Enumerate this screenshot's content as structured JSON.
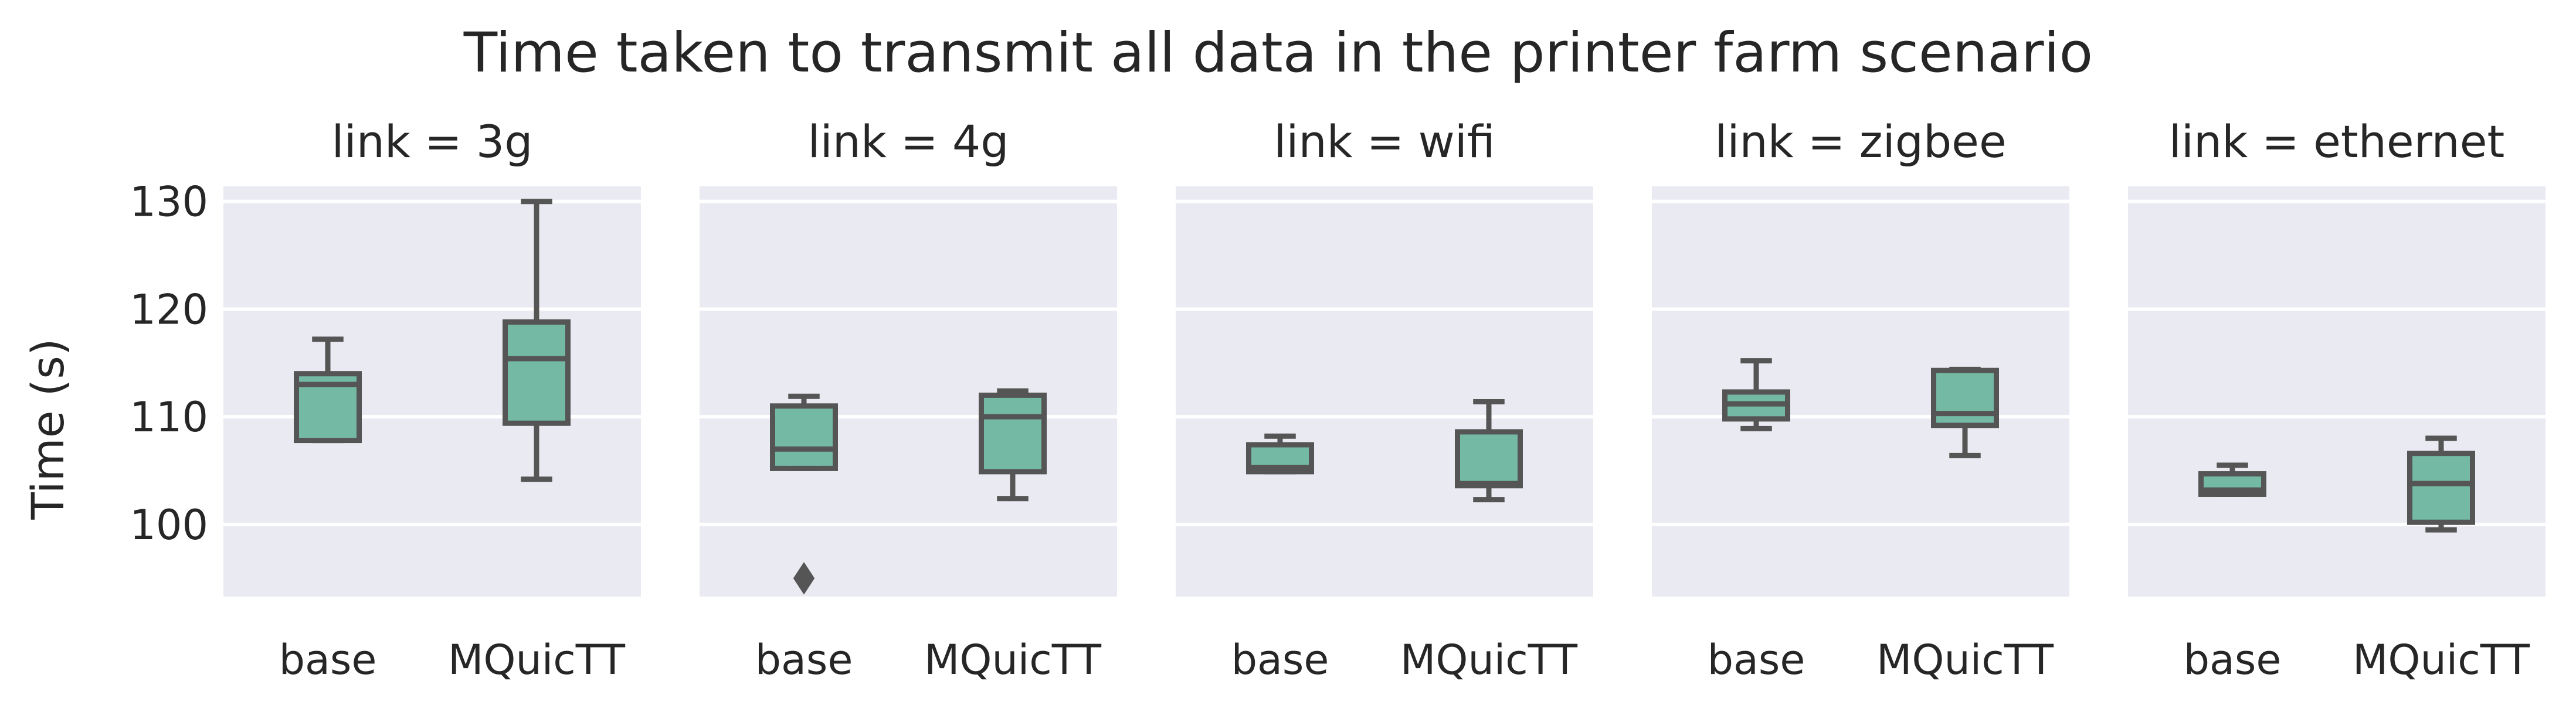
{
  "chart_data": {
    "type": "box",
    "title": "Time taken to transmit all data in the printer farm scenario",
    "ylabel": "Time (s)",
    "xlabel": "",
    "ylim": [
      93.3,
      131.4
    ],
    "yticks": [
      100,
      110,
      120,
      130
    ],
    "categories": [
      "base",
      "MQuicTT"
    ],
    "grid": true,
    "colors": {
      "box": "#73b9a4",
      "edge": "#555555",
      "background": "#eaeaf2"
    },
    "panels": [
      {
        "title": "link = 3g",
        "boxes": [
          {
            "category": "base",
            "whislo": 107.8,
            "q1": 107.8,
            "med": 113.0,
            "q3": 114.0,
            "whishi": 117.2,
            "fliers": []
          },
          {
            "category": "MQuicTT",
            "whislo": 104.2,
            "q1": 109.4,
            "med": 115.4,
            "q3": 118.8,
            "whishi": 130.0,
            "fliers": []
          }
        ]
      },
      {
        "title": "link = 4g",
        "boxes": [
          {
            "category": "base",
            "whislo": 105.2,
            "q1": 105.2,
            "med": 107.0,
            "q3": 111.0,
            "whishi": 111.9,
            "fliers": [
              95.0
            ]
          },
          {
            "category": "MQuicTT",
            "whislo": 102.4,
            "q1": 104.9,
            "med": 110.0,
            "q3": 112.0,
            "whishi": 112.4,
            "fliers": []
          }
        ]
      },
      {
        "title": "link = wifi",
        "boxes": [
          {
            "category": "base",
            "whislo": 104.9,
            "q1": 104.9,
            "med": 105.3,
            "q3": 107.4,
            "whishi": 108.2,
            "fliers": []
          },
          {
            "category": "MQuicTT",
            "whislo": 102.3,
            "q1": 103.6,
            "med": 103.8,
            "q3": 108.6,
            "whishi": 111.4,
            "fliers": []
          }
        ]
      },
      {
        "title": "link = zigbee",
        "boxes": [
          {
            "category": "base",
            "whislo": 108.9,
            "q1": 109.8,
            "med": 111.2,
            "q3": 112.3,
            "whishi": 115.2,
            "fliers": []
          },
          {
            "category": "MQuicTT",
            "whislo": 106.4,
            "q1": 109.2,
            "med": 110.3,
            "q3": 114.3,
            "whishi": 114.4,
            "fliers": []
          }
        ]
      },
      {
        "title": "link = ethernet",
        "boxes": [
          {
            "category": "base",
            "whislo": 102.8,
            "q1": 102.8,
            "med": 103.2,
            "q3": 104.7,
            "whishi": 105.5,
            "fliers": []
          },
          {
            "category": "MQuicTT",
            "whislo": 99.5,
            "q1": 100.2,
            "med": 103.8,
            "q3": 106.6,
            "whishi": 108.0,
            "fliers": []
          }
        ]
      }
    ]
  }
}
